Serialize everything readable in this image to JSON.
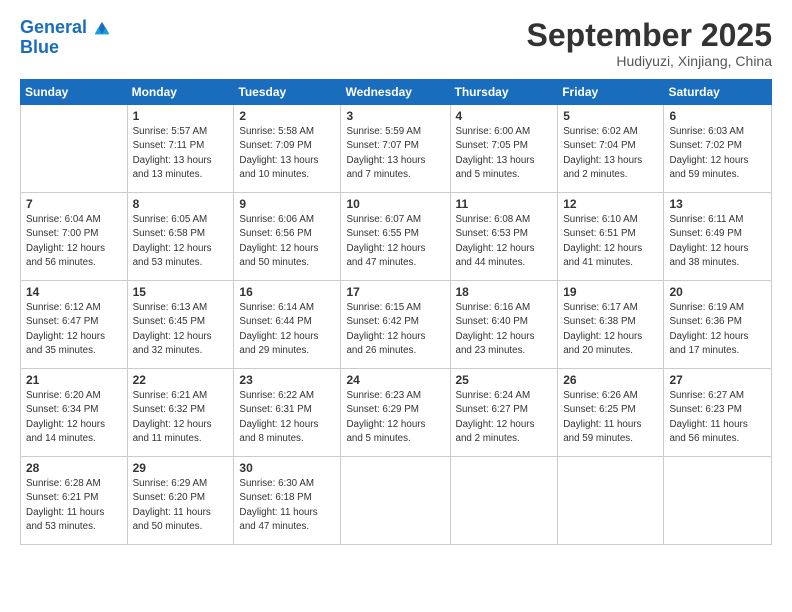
{
  "header": {
    "logo_line1": "General",
    "logo_line2": "Blue",
    "month": "September 2025",
    "location": "Hudiyuzi, Xinjiang, China"
  },
  "weekdays": [
    "Sunday",
    "Monday",
    "Tuesday",
    "Wednesday",
    "Thursday",
    "Friday",
    "Saturday"
  ],
  "weeks": [
    [
      {
        "date": "",
        "info": ""
      },
      {
        "date": "1",
        "info": "Sunrise: 5:57 AM\nSunset: 7:11 PM\nDaylight: 13 hours\nand 13 minutes."
      },
      {
        "date": "2",
        "info": "Sunrise: 5:58 AM\nSunset: 7:09 PM\nDaylight: 13 hours\nand 10 minutes."
      },
      {
        "date": "3",
        "info": "Sunrise: 5:59 AM\nSunset: 7:07 PM\nDaylight: 13 hours\nand 7 minutes."
      },
      {
        "date": "4",
        "info": "Sunrise: 6:00 AM\nSunset: 7:05 PM\nDaylight: 13 hours\nand 5 minutes."
      },
      {
        "date": "5",
        "info": "Sunrise: 6:02 AM\nSunset: 7:04 PM\nDaylight: 13 hours\nand 2 minutes."
      },
      {
        "date": "6",
        "info": "Sunrise: 6:03 AM\nSunset: 7:02 PM\nDaylight: 12 hours\nand 59 minutes."
      }
    ],
    [
      {
        "date": "7",
        "info": "Sunrise: 6:04 AM\nSunset: 7:00 PM\nDaylight: 12 hours\nand 56 minutes."
      },
      {
        "date": "8",
        "info": "Sunrise: 6:05 AM\nSunset: 6:58 PM\nDaylight: 12 hours\nand 53 minutes."
      },
      {
        "date": "9",
        "info": "Sunrise: 6:06 AM\nSunset: 6:56 PM\nDaylight: 12 hours\nand 50 minutes."
      },
      {
        "date": "10",
        "info": "Sunrise: 6:07 AM\nSunset: 6:55 PM\nDaylight: 12 hours\nand 47 minutes."
      },
      {
        "date": "11",
        "info": "Sunrise: 6:08 AM\nSunset: 6:53 PM\nDaylight: 12 hours\nand 44 minutes."
      },
      {
        "date": "12",
        "info": "Sunrise: 6:10 AM\nSunset: 6:51 PM\nDaylight: 12 hours\nand 41 minutes."
      },
      {
        "date": "13",
        "info": "Sunrise: 6:11 AM\nSunset: 6:49 PM\nDaylight: 12 hours\nand 38 minutes."
      }
    ],
    [
      {
        "date": "14",
        "info": "Sunrise: 6:12 AM\nSunset: 6:47 PM\nDaylight: 12 hours\nand 35 minutes."
      },
      {
        "date": "15",
        "info": "Sunrise: 6:13 AM\nSunset: 6:45 PM\nDaylight: 12 hours\nand 32 minutes."
      },
      {
        "date": "16",
        "info": "Sunrise: 6:14 AM\nSunset: 6:44 PM\nDaylight: 12 hours\nand 29 minutes."
      },
      {
        "date": "17",
        "info": "Sunrise: 6:15 AM\nSunset: 6:42 PM\nDaylight: 12 hours\nand 26 minutes."
      },
      {
        "date": "18",
        "info": "Sunrise: 6:16 AM\nSunset: 6:40 PM\nDaylight: 12 hours\nand 23 minutes."
      },
      {
        "date": "19",
        "info": "Sunrise: 6:17 AM\nSunset: 6:38 PM\nDaylight: 12 hours\nand 20 minutes."
      },
      {
        "date": "20",
        "info": "Sunrise: 6:19 AM\nSunset: 6:36 PM\nDaylight: 12 hours\nand 17 minutes."
      }
    ],
    [
      {
        "date": "21",
        "info": "Sunrise: 6:20 AM\nSunset: 6:34 PM\nDaylight: 12 hours\nand 14 minutes."
      },
      {
        "date": "22",
        "info": "Sunrise: 6:21 AM\nSunset: 6:32 PM\nDaylight: 12 hours\nand 11 minutes."
      },
      {
        "date": "23",
        "info": "Sunrise: 6:22 AM\nSunset: 6:31 PM\nDaylight: 12 hours\nand 8 minutes."
      },
      {
        "date": "24",
        "info": "Sunrise: 6:23 AM\nSunset: 6:29 PM\nDaylight: 12 hours\nand 5 minutes."
      },
      {
        "date": "25",
        "info": "Sunrise: 6:24 AM\nSunset: 6:27 PM\nDaylight: 12 hours\nand 2 minutes."
      },
      {
        "date": "26",
        "info": "Sunrise: 6:26 AM\nSunset: 6:25 PM\nDaylight: 11 hours\nand 59 minutes."
      },
      {
        "date": "27",
        "info": "Sunrise: 6:27 AM\nSunset: 6:23 PM\nDaylight: 11 hours\nand 56 minutes."
      }
    ],
    [
      {
        "date": "28",
        "info": "Sunrise: 6:28 AM\nSunset: 6:21 PM\nDaylight: 11 hours\nand 53 minutes."
      },
      {
        "date": "29",
        "info": "Sunrise: 6:29 AM\nSunset: 6:20 PM\nDaylight: 11 hours\nand 50 minutes."
      },
      {
        "date": "30",
        "info": "Sunrise: 6:30 AM\nSunset: 6:18 PM\nDaylight: 11 hours\nand 47 minutes."
      },
      {
        "date": "",
        "info": ""
      },
      {
        "date": "",
        "info": ""
      },
      {
        "date": "",
        "info": ""
      },
      {
        "date": "",
        "info": ""
      }
    ]
  ]
}
